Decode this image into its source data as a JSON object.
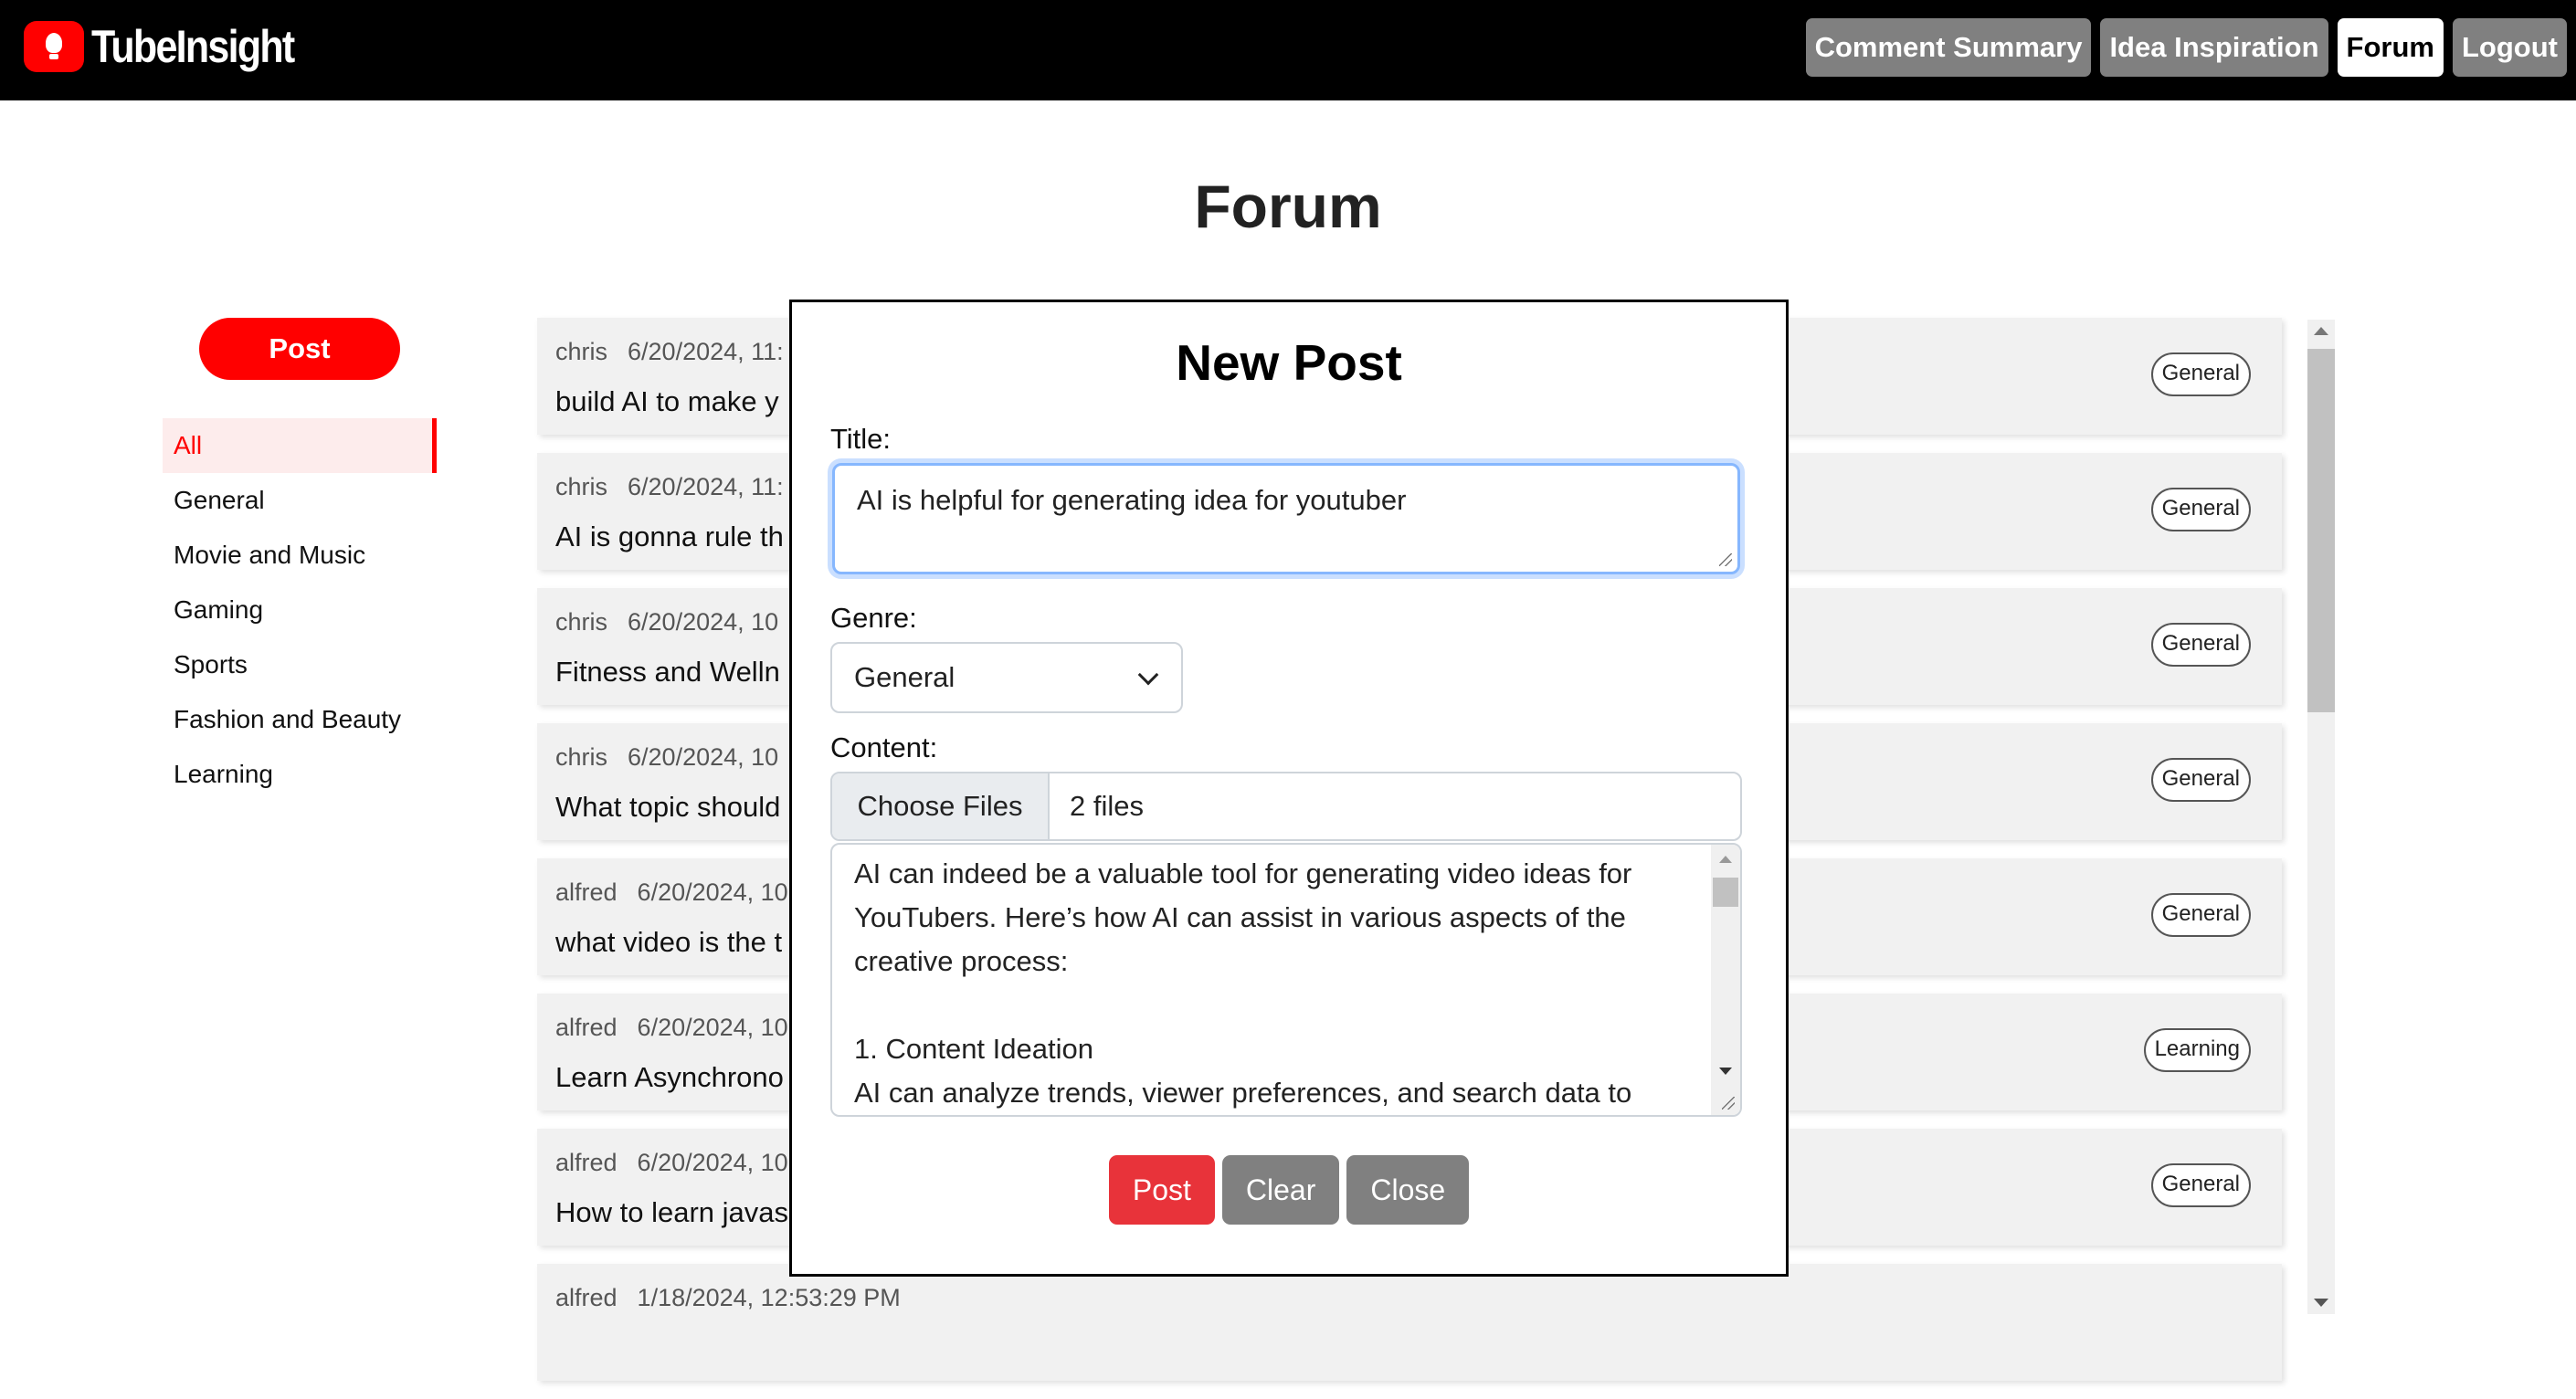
{
  "app": {
    "name": "TubeInsight"
  },
  "nav": {
    "items": [
      {
        "label": "Comment Summary",
        "active": false
      },
      {
        "label": "Idea Inspiration",
        "active": false
      },
      {
        "label": "Forum",
        "active": true
      },
      {
        "label": "Logout",
        "active": false
      }
    ]
  },
  "page": {
    "title": "Forum"
  },
  "sidebar": {
    "post_label": "Post",
    "genres": [
      "All",
      "General",
      "Movie and Music",
      "Gaming",
      "Sports",
      "Fashion and Beauty",
      "Learning"
    ],
    "active": "All"
  },
  "posts": [
    {
      "author": "chris",
      "date": "6/20/2024, 11:",
      "title": "build AI to make y",
      "tag": "General"
    },
    {
      "author": "chris",
      "date": "6/20/2024, 11:",
      "title": "AI is gonna rule th",
      "tag": "General"
    },
    {
      "author": "chris",
      "date": "6/20/2024, 10",
      "title": "Fitness and Welln",
      "tag": "General"
    },
    {
      "author": "chris",
      "date": "6/20/2024, 10",
      "title": "What topic should",
      "tag": "General"
    },
    {
      "author": "alfred",
      "date": "6/20/2024, 10",
      "title": "what video is the t",
      "tag": "General"
    },
    {
      "author": "alfred",
      "date": "6/20/2024, 10",
      "title": "Learn Asynchrono",
      "tag": "Learning"
    },
    {
      "author": "alfred",
      "date": "6/20/2024, 10",
      "title": "How to learn javas",
      "tag": "General"
    },
    {
      "author": "alfred",
      "date": "1/18/2024, 12:53:29 PM",
      "title": "",
      "tag": ""
    }
  ],
  "modal": {
    "title": "New Post",
    "title_label": "Title:",
    "title_value": "AI is helpful for generating idea for youtuber",
    "genre_label": "Genre:",
    "genre_value": "General",
    "content_label": "Content:",
    "choose_files_label": "Choose Files",
    "files_status": "2 files",
    "content_value": "AI can indeed be a valuable tool for generating video ideas for YouTubers. Here’s how AI can assist in various aspects of the creative process:\n\n1. Content Ideation\nAI can analyze trends, viewer preferences, and search data to",
    "buttons": {
      "post": "Post",
      "clear": "Clear",
      "close": "Close"
    }
  },
  "colors": {
    "brand_red": "#ff0000",
    "header_bg": "#000000",
    "nav_gray": "#808080",
    "post_button": "#e8333a"
  }
}
